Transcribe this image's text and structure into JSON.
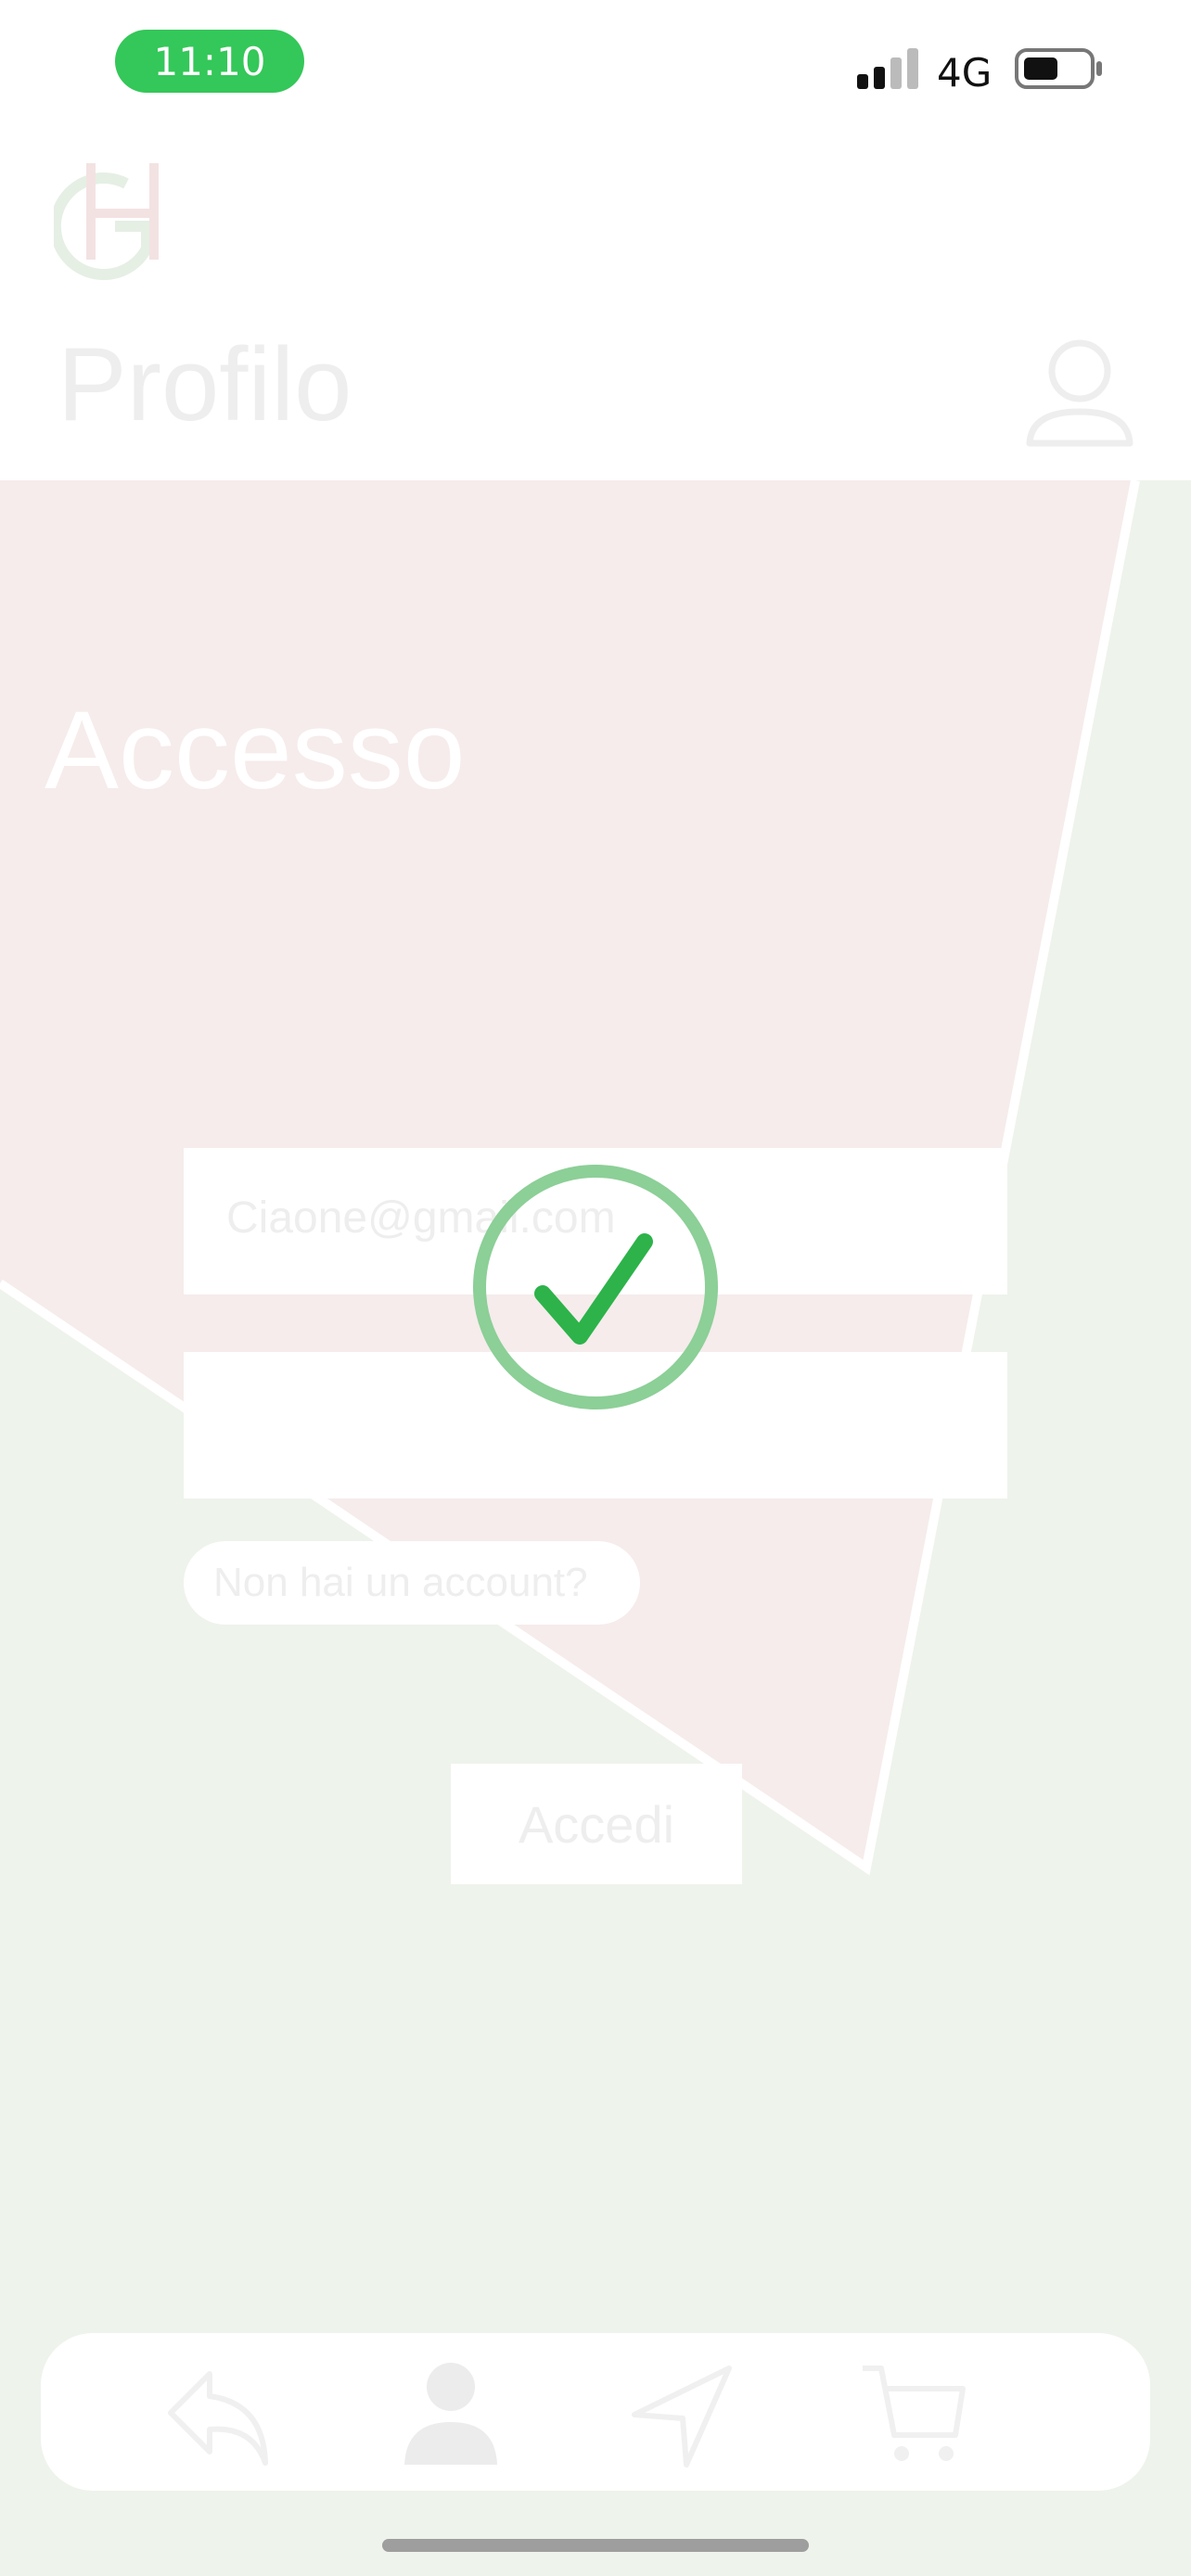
{
  "status_bar": {
    "time": "11:10",
    "network": "4G",
    "time_pill_color": "#34c759"
  },
  "header": {
    "logo_icon": "gh-logo-icon",
    "title": "Profilo",
    "profile_icon": "user-outline-icon"
  },
  "login": {
    "heading": "Accesso",
    "email_value": "Ciaone@gmail.com",
    "password_value": "",
    "register_label": "Non hai un account?",
    "submit_label": "Accedi"
  },
  "overlay": {
    "icon": "success-check-icon",
    "color": "#2db34a"
  },
  "tab_bar": {
    "items": [
      {
        "icon": "back-arrow-icon"
      },
      {
        "icon": "person-icon"
      },
      {
        "icon": "navigation-icon"
      },
      {
        "icon": "cart-icon"
      }
    ]
  },
  "colors": {
    "background": "#eef3ec",
    "pink_panel": "#f5eceb",
    "white": "#ffffff"
  }
}
